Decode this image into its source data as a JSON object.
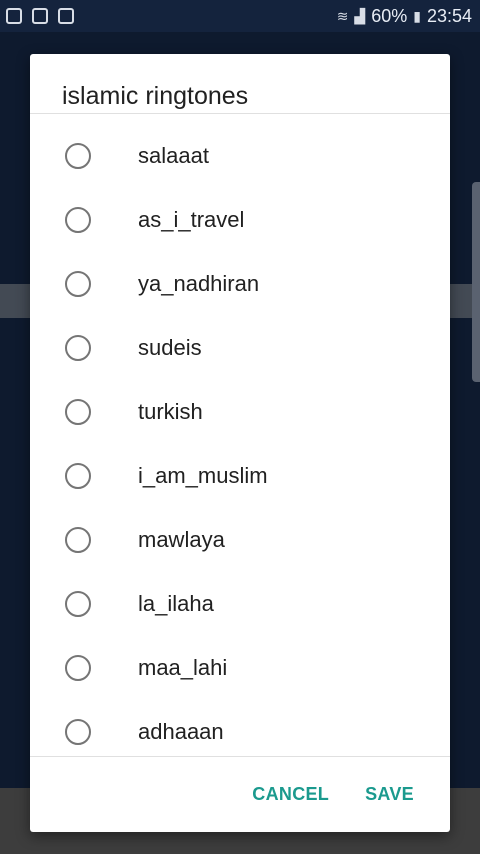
{
  "status_bar": {
    "battery": "60%",
    "time": "23:54",
    "icons": [
      "shield-icon",
      "image-icon",
      "gallery-icon",
      "wifi-icon",
      "signal-icon",
      "battery-icon"
    ]
  },
  "dialog": {
    "title": "islamic ringtones",
    "options": [
      {
        "label": "salaaat",
        "selected": false
      },
      {
        "label": "as_i_travel",
        "selected": false
      },
      {
        "label": "ya_nadhiran",
        "selected": false
      },
      {
        "label": "sudeis",
        "selected": false
      },
      {
        "label": "turkish",
        "selected": false
      },
      {
        "label": "i_am_muslim",
        "selected": false
      },
      {
        "label": "mawlaya",
        "selected": false
      },
      {
        "label": "la_ilaha",
        "selected": false
      },
      {
        "label": "maa_lahi",
        "selected": false
      },
      {
        "label": "adhaaan",
        "selected": false
      }
    ],
    "cancel_label": "CANCEL",
    "save_label": "SAVE"
  },
  "colors": {
    "accent": "#1b9a8e",
    "background": "#0e1a2e"
  }
}
